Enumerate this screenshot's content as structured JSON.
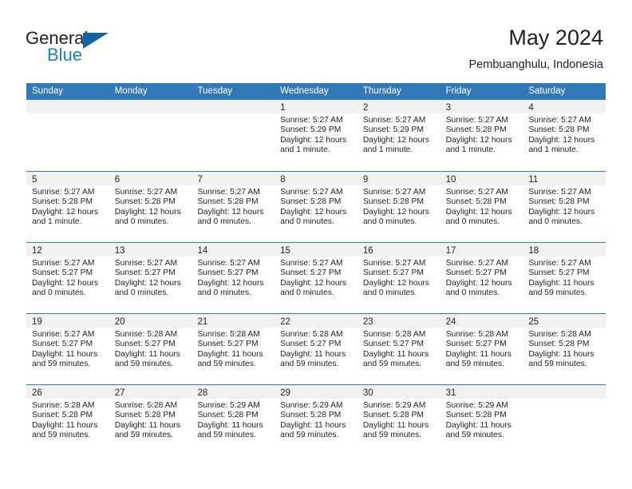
{
  "brand": {
    "name_part1": "General",
    "name_part2": "Blue",
    "triangle_color": "#1461a6",
    "blue_color": "#1f7fc4"
  },
  "header": {
    "month_title": "May 2024",
    "location": "Pembuanghulu, Indonesia"
  },
  "theme": {
    "header_bar_color": "#3379b8",
    "daynum_bar_color": "#f1f1f1",
    "text_color": "#231f20"
  },
  "weekdays": [
    "Sunday",
    "Monday",
    "Tuesday",
    "Wednesday",
    "Thursday",
    "Friday",
    "Saturday"
  ],
  "weeks": [
    [
      {
        "day": "",
        "empty": true,
        "sunrise": "",
        "sunset": "",
        "daylight": ""
      },
      {
        "day": "",
        "empty": true,
        "sunrise": "",
        "sunset": "",
        "daylight": ""
      },
      {
        "day": "",
        "empty": true,
        "sunrise": "",
        "sunset": "",
        "daylight": ""
      },
      {
        "day": "1",
        "empty": false,
        "sunrise": "Sunrise: 5:27 AM",
        "sunset": "Sunset: 5:29 PM",
        "daylight": "Daylight: 12 hours and 1 minute."
      },
      {
        "day": "2",
        "empty": false,
        "sunrise": "Sunrise: 5:27 AM",
        "sunset": "Sunset: 5:29 PM",
        "daylight": "Daylight: 12 hours and 1 minute."
      },
      {
        "day": "3",
        "empty": false,
        "sunrise": "Sunrise: 5:27 AM",
        "sunset": "Sunset: 5:28 PM",
        "daylight": "Daylight: 12 hours and 1 minute."
      },
      {
        "day": "4",
        "empty": false,
        "sunrise": "Sunrise: 5:27 AM",
        "sunset": "Sunset: 5:28 PM",
        "daylight": "Daylight: 12 hours and 1 minute."
      }
    ],
    [
      {
        "day": "5",
        "empty": false,
        "sunrise": "Sunrise: 5:27 AM",
        "sunset": "Sunset: 5:28 PM",
        "daylight": "Daylight: 12 hours and 1 minute."
      },
      {
        "day": "6",
        "empty": false,
        "sunrise": "Sunrise: 5:27 AM",
        "sunset": "Sunset: 5:28 PM",
        "daylight": "Daylight: 12 hours and 0 minutes."
      },
      {
        "day": "7",
        "empty": false,
        "sunrise": "Sunrise: 5:27 AM",
        "sunset": "Sunset: 5:28 PM",
        "daylight": "Daylight: 12 hours and 0 minutes."
      },
      {
        "day": "8",
        "empty": false,
        "sunrise": "Sunrise: 5:27 AM",
        "sunset": "Sunset: 5:28 PM",
        "daylight": "Daylight: 12 hours and 0 minutes."
      },
      {
        "day": "9",
        "empty": false,
        "sunrise": "Sunrise: 5:27 AM",
        "sunset": "Sunset: 5:28 PM",
        "daylight": "Daylight: 12 hours and 0 minutes."
      },
      {
        "day": "10",
        "empty": false,
        "sunrise": "Sunrise: 5:27 AM",
        "sunset": "Sunset: 5:28 PM",
        "daylight": "Daylight: 12 hours and 0 minutes."
      },
      {
        "day": "11",
        "empty": false,
        "sunrise": "Sunrise: 5:27 AM",
        "sunset": "Sunset: 5:28 PM",
        "daylight": "Daylight: 12 hours and 0 minutes."
      }
    ],
    [
      {
        "day": "12",
        "empty": false,
        "sunrise": "Sunrise: 5:27 AM",
        "sunset": "Sunset: 5:27 PM",
        "daylight": "Daylight: 12 hours and 0 minutes."
      },
      {
        "day": "13",
        "empty": false,
        "sunrise": "Sunrise: 5:27 AM",
        "sunset": "Sunset: 5:27 PM",
        "daylight": "Daylight: 12 hours and 0 minutes."
      },
      {
        "day": "14",
        "empty": false,
        "sunrise": "Sunrise: 5:27 AM",
        "sunset": "Sunset: 5:27 PM",
        "daylight": "Daylight: 12 hours and 0 minutes."
      },
      {
        "day": "15",
        "empty": false,
        "sunrise": "Sunrise: 5:27 AM",
        "sunset": "Sunset: 5:27 PM",
        "daylight": "Daylight: 12 hours and 0 minutes."
      },
      {
        "day": "16",
        "empty": false,
        "sunrise": "Sunrise: 5:27 AM",
        "sunset": "Sunset: 5:27 PM",
        "daylight": "Daylight: 12 hours and 0 minutes."
      },
      {
        "day": "17",
        "empty": false,
        "sunrise": "Sunrise: 5:27 AM",
        "sunset": "Sunset: 5:27 PM",
        "daylight": "Daylight: 12 hours and 0 minutes."
      },
      {
        "day": "18",
        "empty": false,
        "sunrise": "Sunrise: 5:27 AM",
        "sunset": "Sunset: 5:27 PM",
        "daylight": "Daylight: 11 hours and 59 minutes."
      }
    ],
    [
      {
        "day": "19",
        "empty": false,
        "sunrise": "Sunrise: 5:27 AM",
        "sunset": "Sunset: 5:27 PM",
        "daylight": "Daylight: 11 hours and 59 minutes."
      },
      {
        "day": "20",
        "empty": false,
        "sunrise": "Sunrise: 5:28 AM",
        "sunset": "Sunset: 5:27 PM",
        "daylight": "Daylight: 11 hours and 59 minutes."
      },
      {
        "day": "21",
        "empty": false,
        "sunrise": "Sunrise: 5:28 AM",
        "sunset": "Sunset: 5:27 PM",
        "daylight": "Daylight: 11 hours and 59 minutes."
      },
      {
        "day": "22",
        "empty": false,
        "sunrise": "Sunrise: 5:28 AM",
        "sunset": "Sunset: 5:27 PM",
        "daylight": "Daylight: 11 hours and 59 minutes."
      },
      {
        "day": "23",
        "empty": false,
        "sunrise": "Sunrise: 5:28 AM",
        "sunset": "Sunset: 5:27 PM",
        "daylight": "Daylight: 11 hours and 59 minutes."
      },
      {
        "day": "24",
        "empty": false,
        "sunrise": "Sunrise: 5:28 AM",
        "sunset": "Sunset: 5:27 PM",
        "daylight": "Daylight: 11 hours and 59 minutes."
      },
      {
        "day": "25",
        "empty": false,
        "sunrise": "Sunrise: 5:28 AM",
        "sunset": "Sunset: 5:28 PM",
        "daylight": "Daylight: 11 hours and 59 minutes."
      }
    ],
    [
      {
        "day": "26",
        "empty": false,
        "sunrise": "Sunrise: 5:28 AM",
        "sunset": "Sunset: 5:28 PM",
        "daylight": "Daylight: 11 hours and 59 minutes."
      },
      {
        "day": "27",
        "empty": false,
        "sunrise": "Sunrise: 5:28 AM",
        "sunset": "Sunset: 5:28 PM",
        "daylight": "Daylight: 11 hours and 59 minutes."
      },
      {
        "day": "28",
        "empty": false,
        "sunrise": "Sunrise: 5:29 AM",
        "sunset": "Sunset: 5:28 PM",
        "daylight": "Daylight: 11 hours and 59 minutes."
      },
      {
        "day": "29",
        "empty": false,
        "sunrise": "Sunrise: 5:29 AM",
        "sunset": "Sunset: 5:28 PM",
        "daylight": "Daylight: 11 hours and 59 minutes."
      },
      {
        "day": "30",
        "empty": false,
        "sunrise": "Sunrise: 5:29 AM",
        "sunset": "Sunset: 5:28 PM",
        "daylight": "Daylight: 11 hours and 59 minutes."
      },
      {
        "day": "31",
        "empty": false,
        "sunrise": "Sunrise: 5:29 AM",
        "sunset": "Sunset: 5:28 PM",
        "daylight": "Daylight: 11 hours and 59 minutes."
      },
      {
        "day": "",
        "empty": true,
        "sunrise": "",
        "sunset": "",
        "daylight": ""
      }
    ]
  ]
}
